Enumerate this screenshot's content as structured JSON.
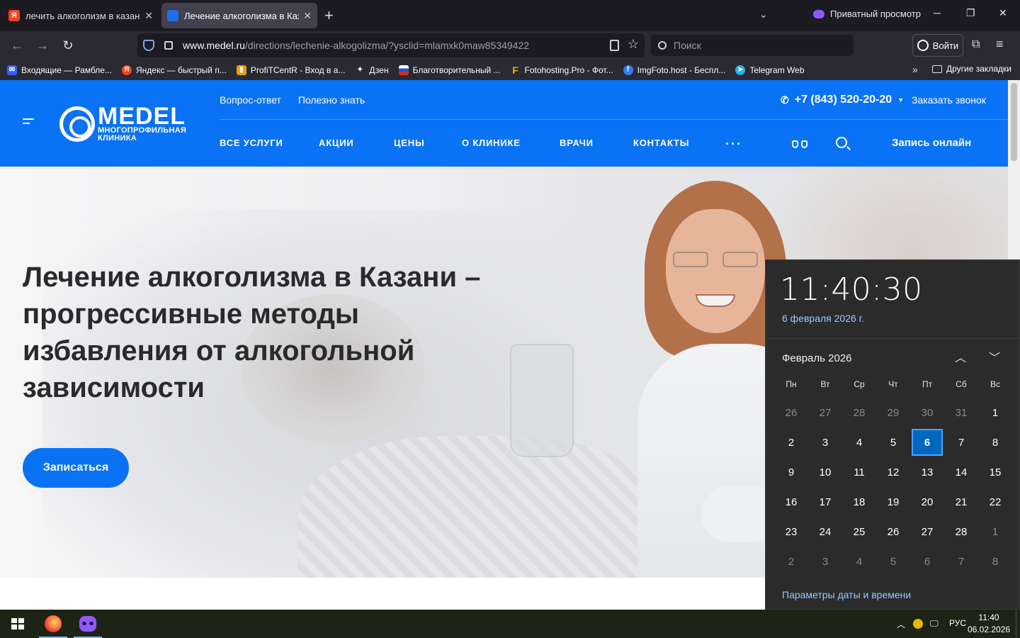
{
  "browser": {
    "tabs": [
      {
        "title": "лечить алкоголизм в казани — ",
        "favicon": "yandex-icon",
        "active": false
      },
      {
        "title": "Лечение алкоголизма в Казани",
        "favicon": "medel-icon",
        "active": true
      }
    ],
    "private_label": "Приватный просмотр",
    "url_host": "www.medel.ru",
    "url_path": "/directions/lechenie-alkogolizma/?ysclid=mlamxk0maw85349422",
    "search_placeholder": "Поиск",
    "login_label": "Войти",
    "bookmarks": [
      {
        "label": "Входящие — Рамбле...",
        "icon": "rambler-mail-icon",
        "color": "#315efb"
      },
      {
        "label": "Яндекс — быстрый п...",
        "icon": "yandex-icon",
        "color": "#fc3f1d"
      },
      {
        "label": "ProfiTCentR - Вход в а...",
        "icon": "chart-icon",
        "color": "#e6a100"
      },
      {
        "label": "Дзен",
        "icon": "dzen-icon",
        "color": "#2b2a33"
      },
      {
        "label": "Благотворительный ...",
        "icon": "flag-icon",
        "color": "#d52b1e"
      },
      {
        "label": "Fotohosting.Pro - Фот...",
        "icon": "fotohosting-icon",
        "color": "#f5b400"
      },
      {
        "label": "ImgFoto.host - Беспл...",
        "icon": "imgfoto-icon",
        "color": "#2f7cf6"
      },
      {
        "label": "Telegram Web",
        "icon": "telegram-icon",
        "color": "#2aabee"
      }
    ],
    "other_bookmarks": "Другие закладки"
  },
  "site": {
    "logo_name": "MEDEL",
    "logo_sub1": "МНОГОПРОФИЛЬНАЯ",
    "logo_sub2": "КЛИНИКА",
    "top_links": [
      "Вопрос-ответ",
      "Полезно знать"
    ],
    "phone": "+7 (843) 520-20-20",
    "callback": "Заказать звонок",
    "nav": [
      "ВСЕ УСЛУГИ",
      "АКЦИИ",
      "ЦЕНЫ",
      "О КЛИНИКЕ",
      "ВРАЧИ",
      "КОНТАКТЫ"
    ],
    "more": "···",
    "online_booking": "Запись онлайн",
    "headline": "Лечение алкоголизма в Казани – прогрессивные методы избавления от алкогольной зависимости",
    "cta": "Записаться",
    "brand_color": "#0a72f5"
  },
  "flyout": {
    "time": "11:40:30",
    "date": "6 февраля 2026 г.",
    "month": "Февраль 2026",
    "weekdays": [
      "Пн",
      "Вт",
      "Ср",
      "Чт",
      "Пт",
      "Сб",
      "Вс"
    ],
    "days": [
      [
        "26",
        "27",
        "28",
        "29",
        "30",
        "31",
        "1"
      ],
      [
        "2",
        "3",
        "4",
        "5",
        "6",
        "7",
        "8"
      ],
      [
        "9",
        "10",
        "11",
        "12",
        "13",
        "14",
        "15"
      ],
      [
        "16",
        "17",
        "18",
        "19",
        "20",
        "21",
        "22"
      ],
      [
        "23",
        "24",
        "25",
        "26",
        "27",
        "28",
        "1"
      ],
      [
        "2",
        "3",
        "4",
        "5",
        "6",
        "7",
        "8"
      ]
    ],
    "today": "6",
    "settings_link": "Параметры даты и времени"
  },
  "taskbar": {
    "lang": "РУС",
    "time": "11:40",
    "date": "06.02.2026"
  }
}
